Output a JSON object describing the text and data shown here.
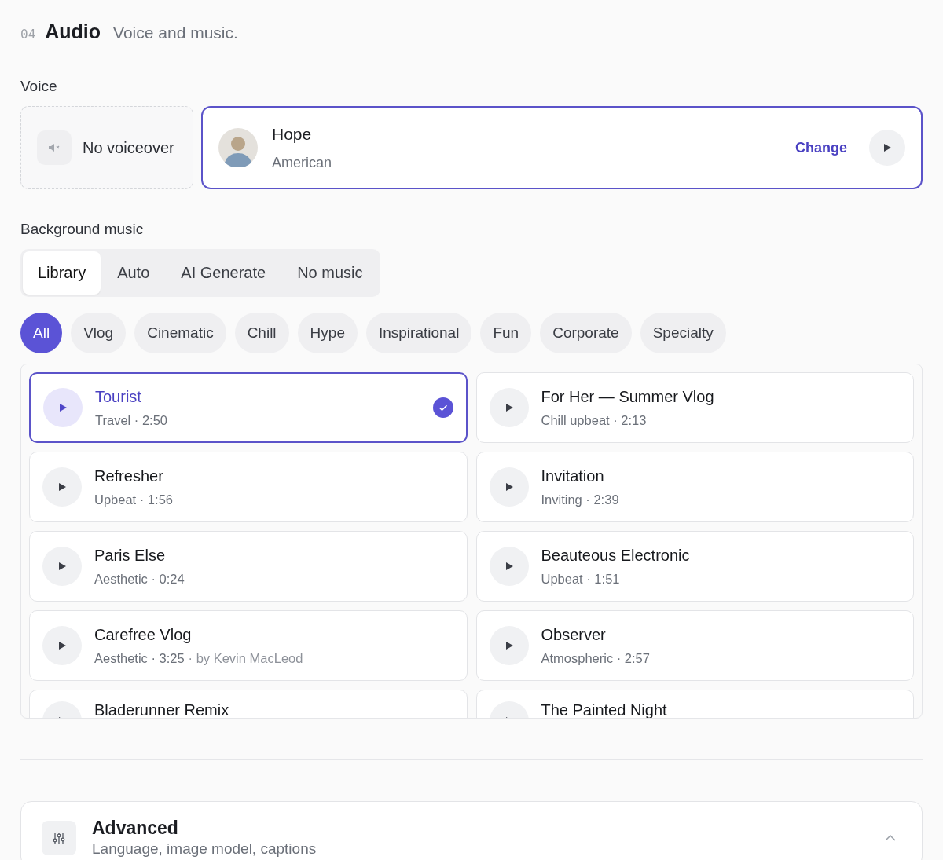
{
  "section": {
    "number": "04",
    "title": "Audio",
    "subtitle": "Voice and music."
  },
  "voice": {
    "label": "Voice",
    "none_option": {
      "label": "No voiceover",
      "selected": false
    },
    "selected_voice": {
      "name": "Hope",
      "accent": "American",
      "selected": true,
      "change_label": "Change"
    }
  },
  "music": {
    "label": "Background music",
    "tabs": [
      {
        "label": "Library",
        "selected": true
      },
      {
        "label": "Auto",
        "selected": false
      },
      {
        "label": "AI Generate",
        "selected": false
      },
      {
        "label": "No music",
        "selected": false
      }
    ],
    "categories": [
      {
        "label": "All",
        "selected": true
      },
      {
        "label": "Vlog",
        "selected": false
      },
      {
        "label": "Cinematic",
        "selected": false
      },
      {
        "label": "Chill",
        "selected": false
      },
      {
        "label": "Hype",
        "selected": false
      },
      {
        "label": "Inspirational",
        "selected": false
      },
      {
        "label": "Fun",
        "selected": false
      },
      {
        "label": "Corporate",
        "selected": false
      },
      {
        "label": "Specialty",
        "selected": false
      }
    ],
    "tracks": [
      {
        "title": "Tourist",
        "meta": "Travel · 2:50",
        "selected": true
      },
      {
        "title": "For Her — Summer Vlog",
        "meta": "Chill upbeat · 2:13",
        "selected": false
      },
      {
        "title": "Refresher",
        "meta": "Upbeat · 1:56",
        "selected": false
      },
      {
        "title": "Invitation",
        "meta": "Inviting · 2:39",
        "selected": false
      },
      {
        "title": "Paris Else",
        "meta": "Aesthetic · 0:24",
        "selected": false
      },
      {
        "title": "Beauteous Electronic",
        "meta": "Upbeat · 1:51",
        "selected": false
      },
      {
        "title": "Carefree Vlog",
        "meta": "Aesthetic · 3:25",
        "credit": "· by Kevin MacLeod",
        "selected": false
      },
      {
        "title": "Observer",
        "meta": "Atmospheric · 2:57",
        "selected": false
      },
      {
        "title": "Bladerunner Remix",
        "selected": false
      },
      {
        "title": "The Painted Night",
        "selected": false
      }
    ]
  },
  "advanced": {
    "title": "Advanced",
    "subtitle": "Language, image model, captions",
    "expanded": true
  }
}
